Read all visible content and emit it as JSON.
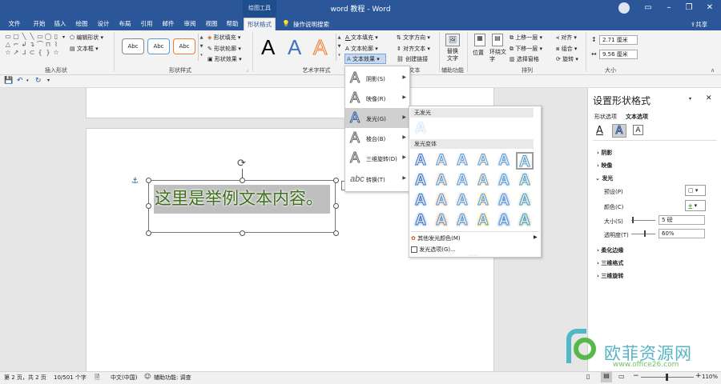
{
  "titlebar": {
    "contextual_label": "绘图工具",
    "doc_title": "word 教程  -  Word",
    "share_label": "共享"
  },
  "tabs": [
    "文件",
    "开始",
    "插入",
    "绘图",
    "设计",
    "布局",
    "引用",
    "邮件",
    "审阅",
    "视图",
    "帮助",
    "形状格式"
  ],
  "tellme": "操作说明搜索",
  "ribbon": {
    "insert_shapes": {
      "edit_shape": "编辑形状",
      "textbox": "文本框",
      "label": "插入形状"
    },
    "shape_styles": {
      "swatch_text": "Abc",
      "fill": "形状填充",
      "outline": "形状轮廓",
      "effects": "形状效果",
      "label": "形状样式"
    },
    "wordart": {
      "letter": "A",
      "text_fill": "文本填充",
      "text_outline": "文本轮廓",
      "text_effects": "文本效果",
      "label": "艺术字样式"
    },
    "text": {
      "direction": "文字方向",
      "align": "对齐文本",
      "link": "创建链接",
      "label": "文本"
    },
    "accessibility": {
      "alt_text": "替换文字",
      "label": "辅助功能"
    },
    "arrange": {
      "position": "位置",
      "wrap": "环绕文字",
      "forward": "上移一层",
      "backward": "下移一层",
      "selection_pane": "选择窗格",
      "align": "对齐",
      "group": "组合",
      "rotate": "旋转",
      "label": "排列"
    },
    "size": {
      "height": "2.71 厘米",
      "width": "9.56 厘米",
      "label": "大小"
    }
  },
  "document": {
    "textbox_text": "这里是举例文本内容。"
  },
  "effects_menu": {
    "items": [
      {
        "label": "阴影(S)"
      },
      {
        "label": "映像(R)"
      },
      {
        "label": "发光(G)"
      },
      {
        "label": "棱台(B)"
      },
      {
        "label": "三维旋转(D)"
      },
      {
        "label": "转换(T)"
      }
    ],
    "transform_icon_text": "abc"
  },
  "glow_menu": {
    "no_glow": "无发光",
    "variants": "发光变体",
    "letter": "A",
    "more_colors": "其他发光颜色(M)",
    "options": "发光选项(G)...",
    "colors": [
      "#5b9bd5",
      "#ed7d31",
      "#a5a5a5",
      "#ffc000",
      "#4472c4",
      "#70ad47"
    ]
  },
  "format_pane": {
    "title": "设置形状格式",
    "tab_shape": "形状选项",
    "tab_text": "文本选项",
    "sections": {
      "shadow": "阴影",
      "reflection": "映像",
      "glow": "发光",
      "soft_edges": "柔化边缘",
      "format_3d": "三维格式",
      "rotation_3d": "三维旋转"
    },
    "preset_label": "预设(P)",
    "color_label": "颜色(C)",
    "size_label": "大小(S)",
    "size_value": "5 磅",
    "transparency_label": "透明度(T)",
    "transparency_value": "60%"
  },
  "status": {
    "page": "第 2 页，共 2 页",
    "words": "10/501 个字",
    "language": "中文(中国)",
    "accessibility": "辅助功能: 调查",
    "zoom": "110%"
  },
  "watermark": {
    "text": "欧菲资源网",
    "url": "www.office26.com"
  }
}
